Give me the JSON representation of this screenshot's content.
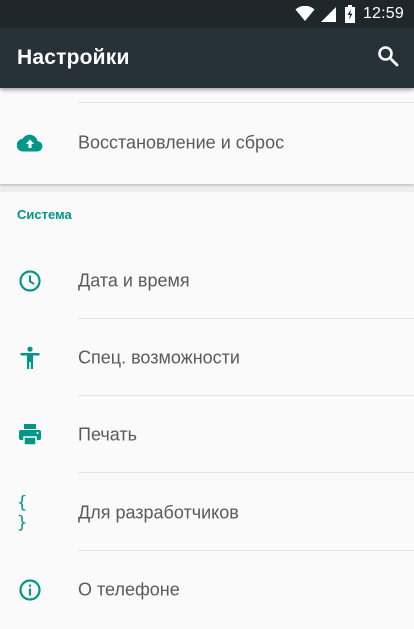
{
  "status_bar": {
    "time": "12:59",
    "icons": [
      "wifi-icon",
      "cell-signal-icon",
      "battery-charging-icon"
    ]
  },
  "toolbar": {
    "title": "Настройки",
    "search_icon": "search-icon"
  },
  "colors": {
    "accent": "#009688",
    "toolbar_bg": "#263238",
    "status_bar_bg": "#1f272b",
    "background": "#fafafa",
    "text": "#5a5a5a"
  },
  "top_card": {
    "item": {
      "label": "Восстановление и сброс",
      "icon": "cloud-upload-icon"
    }
  },
  "system_section": {
    "header": "Система",
    "items": [
      {
        "label": "Дата и время",
        "icon": "clock-icon"
      },
      {
        "label": "Спец. возможности",
        "icon": "accessibility-icon"
      },
      {
        "label": "Печать",
        "icon": "printer-icon"
      },
      {
        "label": "Для разработчиков",
        "icon": "braces-icon",
        "glyph": "{ }"
      },
      {
        "label": "О телефоне",
        "icon": "info-icon"
      }
    ]
  }
}
